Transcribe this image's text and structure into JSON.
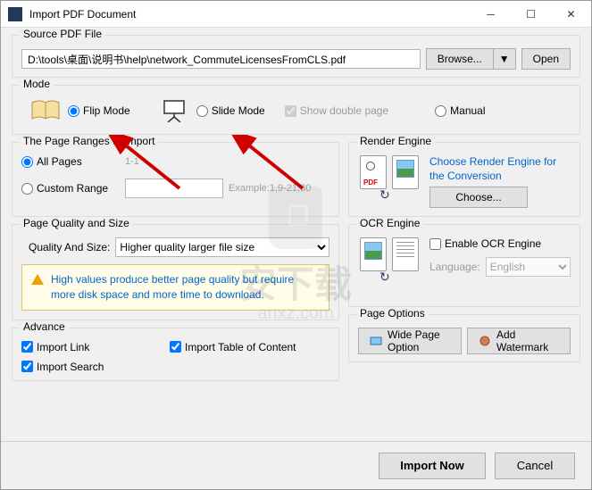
{
  "window": {
    "title": "Import PDF Document"
  },
  "source": {
    "group_label": "Source PDF File",
    "path": "D:\\tools\\桌面\\说明书\\help\\network_CommuteLicensesFromCLS.pdf",
    "browse_label": "Browse...",
    "open_label": "Open"
  },
  "mode": {
    "group_label": "Mode",
    "flip_label": "Flip Mode",
    "slide_label": "Slide Mode",
    "show_double_label": "Show double page",
    "manual_label": "Manual",
    "selected": "flip"
  },
  "pages": {
    "group_label": "The Page Ranges to Import",
    "all_label": "All Pages",
    "all_hint": "1-1",
    "custom_label": "Custom Range",
    "example_label": "Example:1,9-21,30",
    "selected": "all"
  },
  "quality": {
    "group_label": "Page Quality and Size",
    "label": "Quality And Size:",
    "selected_option": "Higher quality larger file size",
    "warn_text": "High values produce better page quality but require more disk space and more time to download."
  },
  "advance": {
    "group_label": "Advance",
    "import_link_label": "Import Link",
    "import_toc_label": "Import Table of Content",
    "import_search_label": "Import Search"
  },
  "render": {
    "group_label": "Render Engine",
    "link_text": "Choose Render Engine for the Conversion",
    "choose_label": "Choose..."
  },
  "ocr": {
    "group_label": "OCR Engine",
    "enable_label": "Enable OCR Engine",
    "language_label": "Language:",
    "language_value": "English"
  },
  "page_options": {
    "group_label": "Page Options",
    "wide_label": "Wide Page Option",
    "watermark_label": "Add Watermark"
  },
  "footer": {
    "import_label": "Import Now",
    "cancel_label": "Cancel"
  },
  "watermark": {
    "brand_cn": "安下载",
    "brand_en": "anxz.com"
  }
}
